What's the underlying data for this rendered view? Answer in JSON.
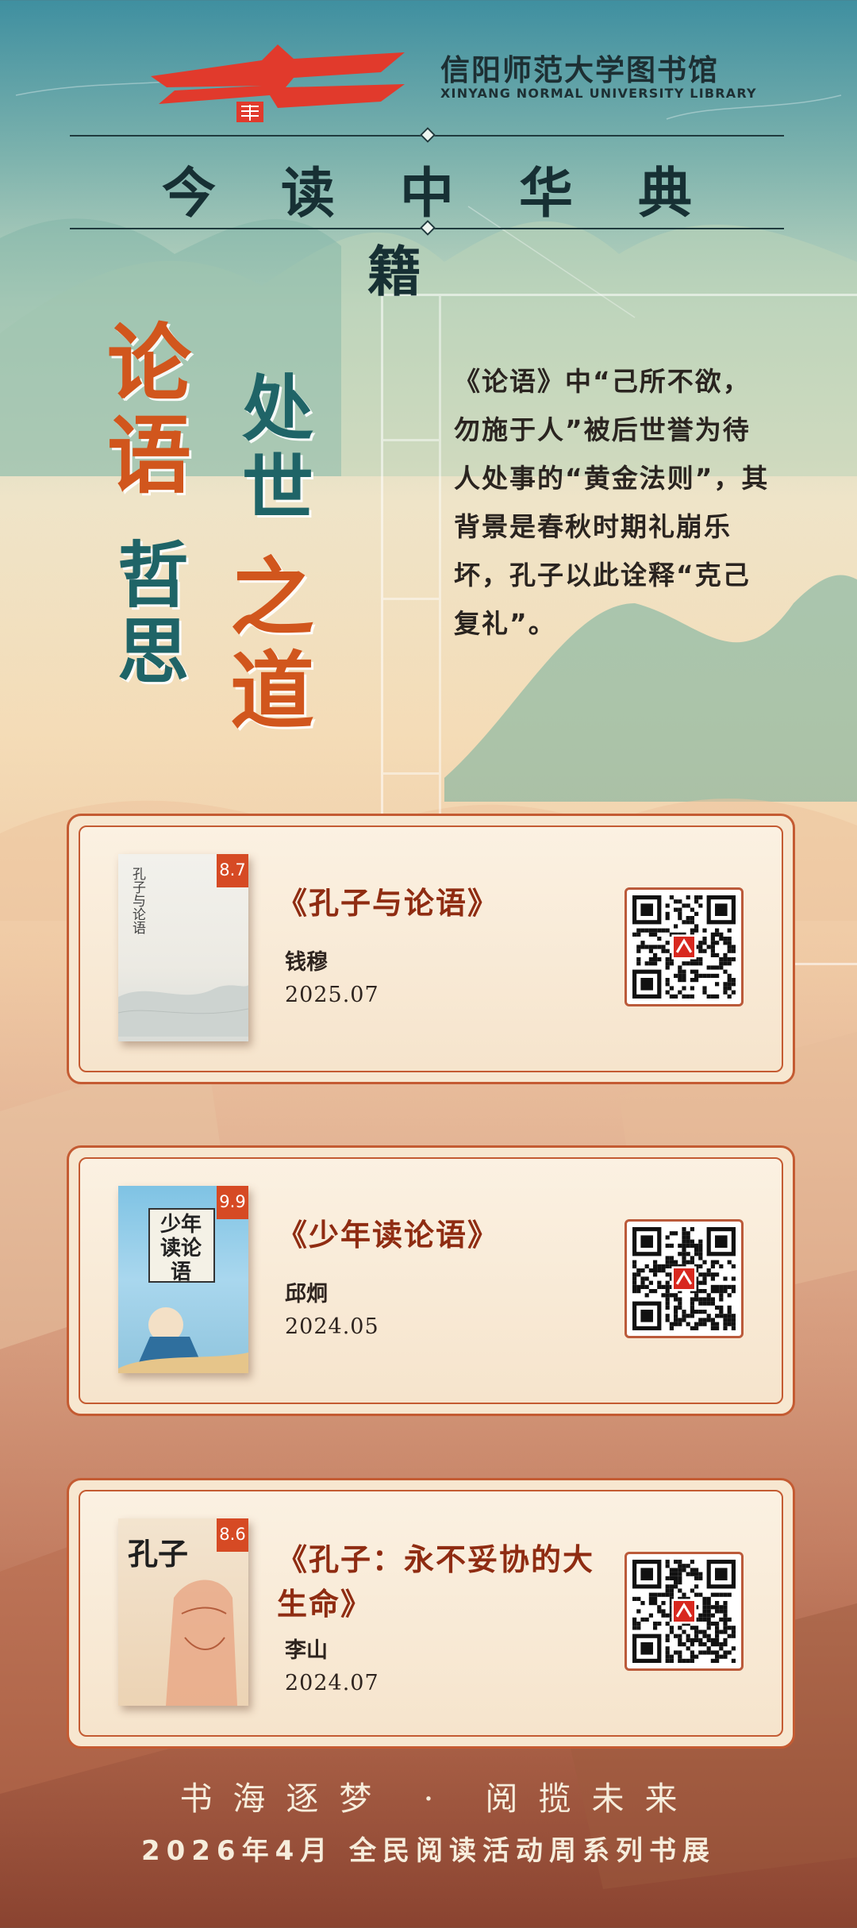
{
  "header": {
    "library_name_cn": "信阳师范大学图书馆",
    "library_name_en": "XINYANG NORMAL UNIVERSITY LIBRARY",
    "main_title": "今读中华典籍"
  },
  "theme": {
    "col1": [
      "论",
      "语",
      "哲",
      "思"
    ],
    "col2": [
      "处",
      "世",
      "之",
      "道"
    ],
    "intro": "《论语》中“己所不欲，勿施于人”被后世誉为待人处事的“黄金法则”，其背景是春秋时期礼崩乐坏，孔子以此诠释“克己复礼”。"
  },
  "books": [
    {
      "title": "《孔子与论语》",
      "author": "钱穆",
      "date": "2025.07",
      "score": "8.7",
      "cover_text": "孔子与论语"
    },
    {
      "title": "《少年读论语》",
      "author": "邱炯",
      "date": "2024.05",
      "score": "9.9",
      "cover_text": "少年读论语"
    },
    {
      "title": "《孔子：永不妥协的大生命》",
      "author": "李山",
      "date": "2024.07",
      "score": "8.6",
      "cover_text": "孔子"
    }
  ],
  "footer": {
    "slogan": "书海逐梦 · 阅揽未来",
    "sub": "2026年4月 全民阅读活动周系列书展"
  },
  "colors": {
    "accent": "#c45b32",
    "title_teal": "#1f6467",
    "title_orange": "#d1561d"
  }
}
